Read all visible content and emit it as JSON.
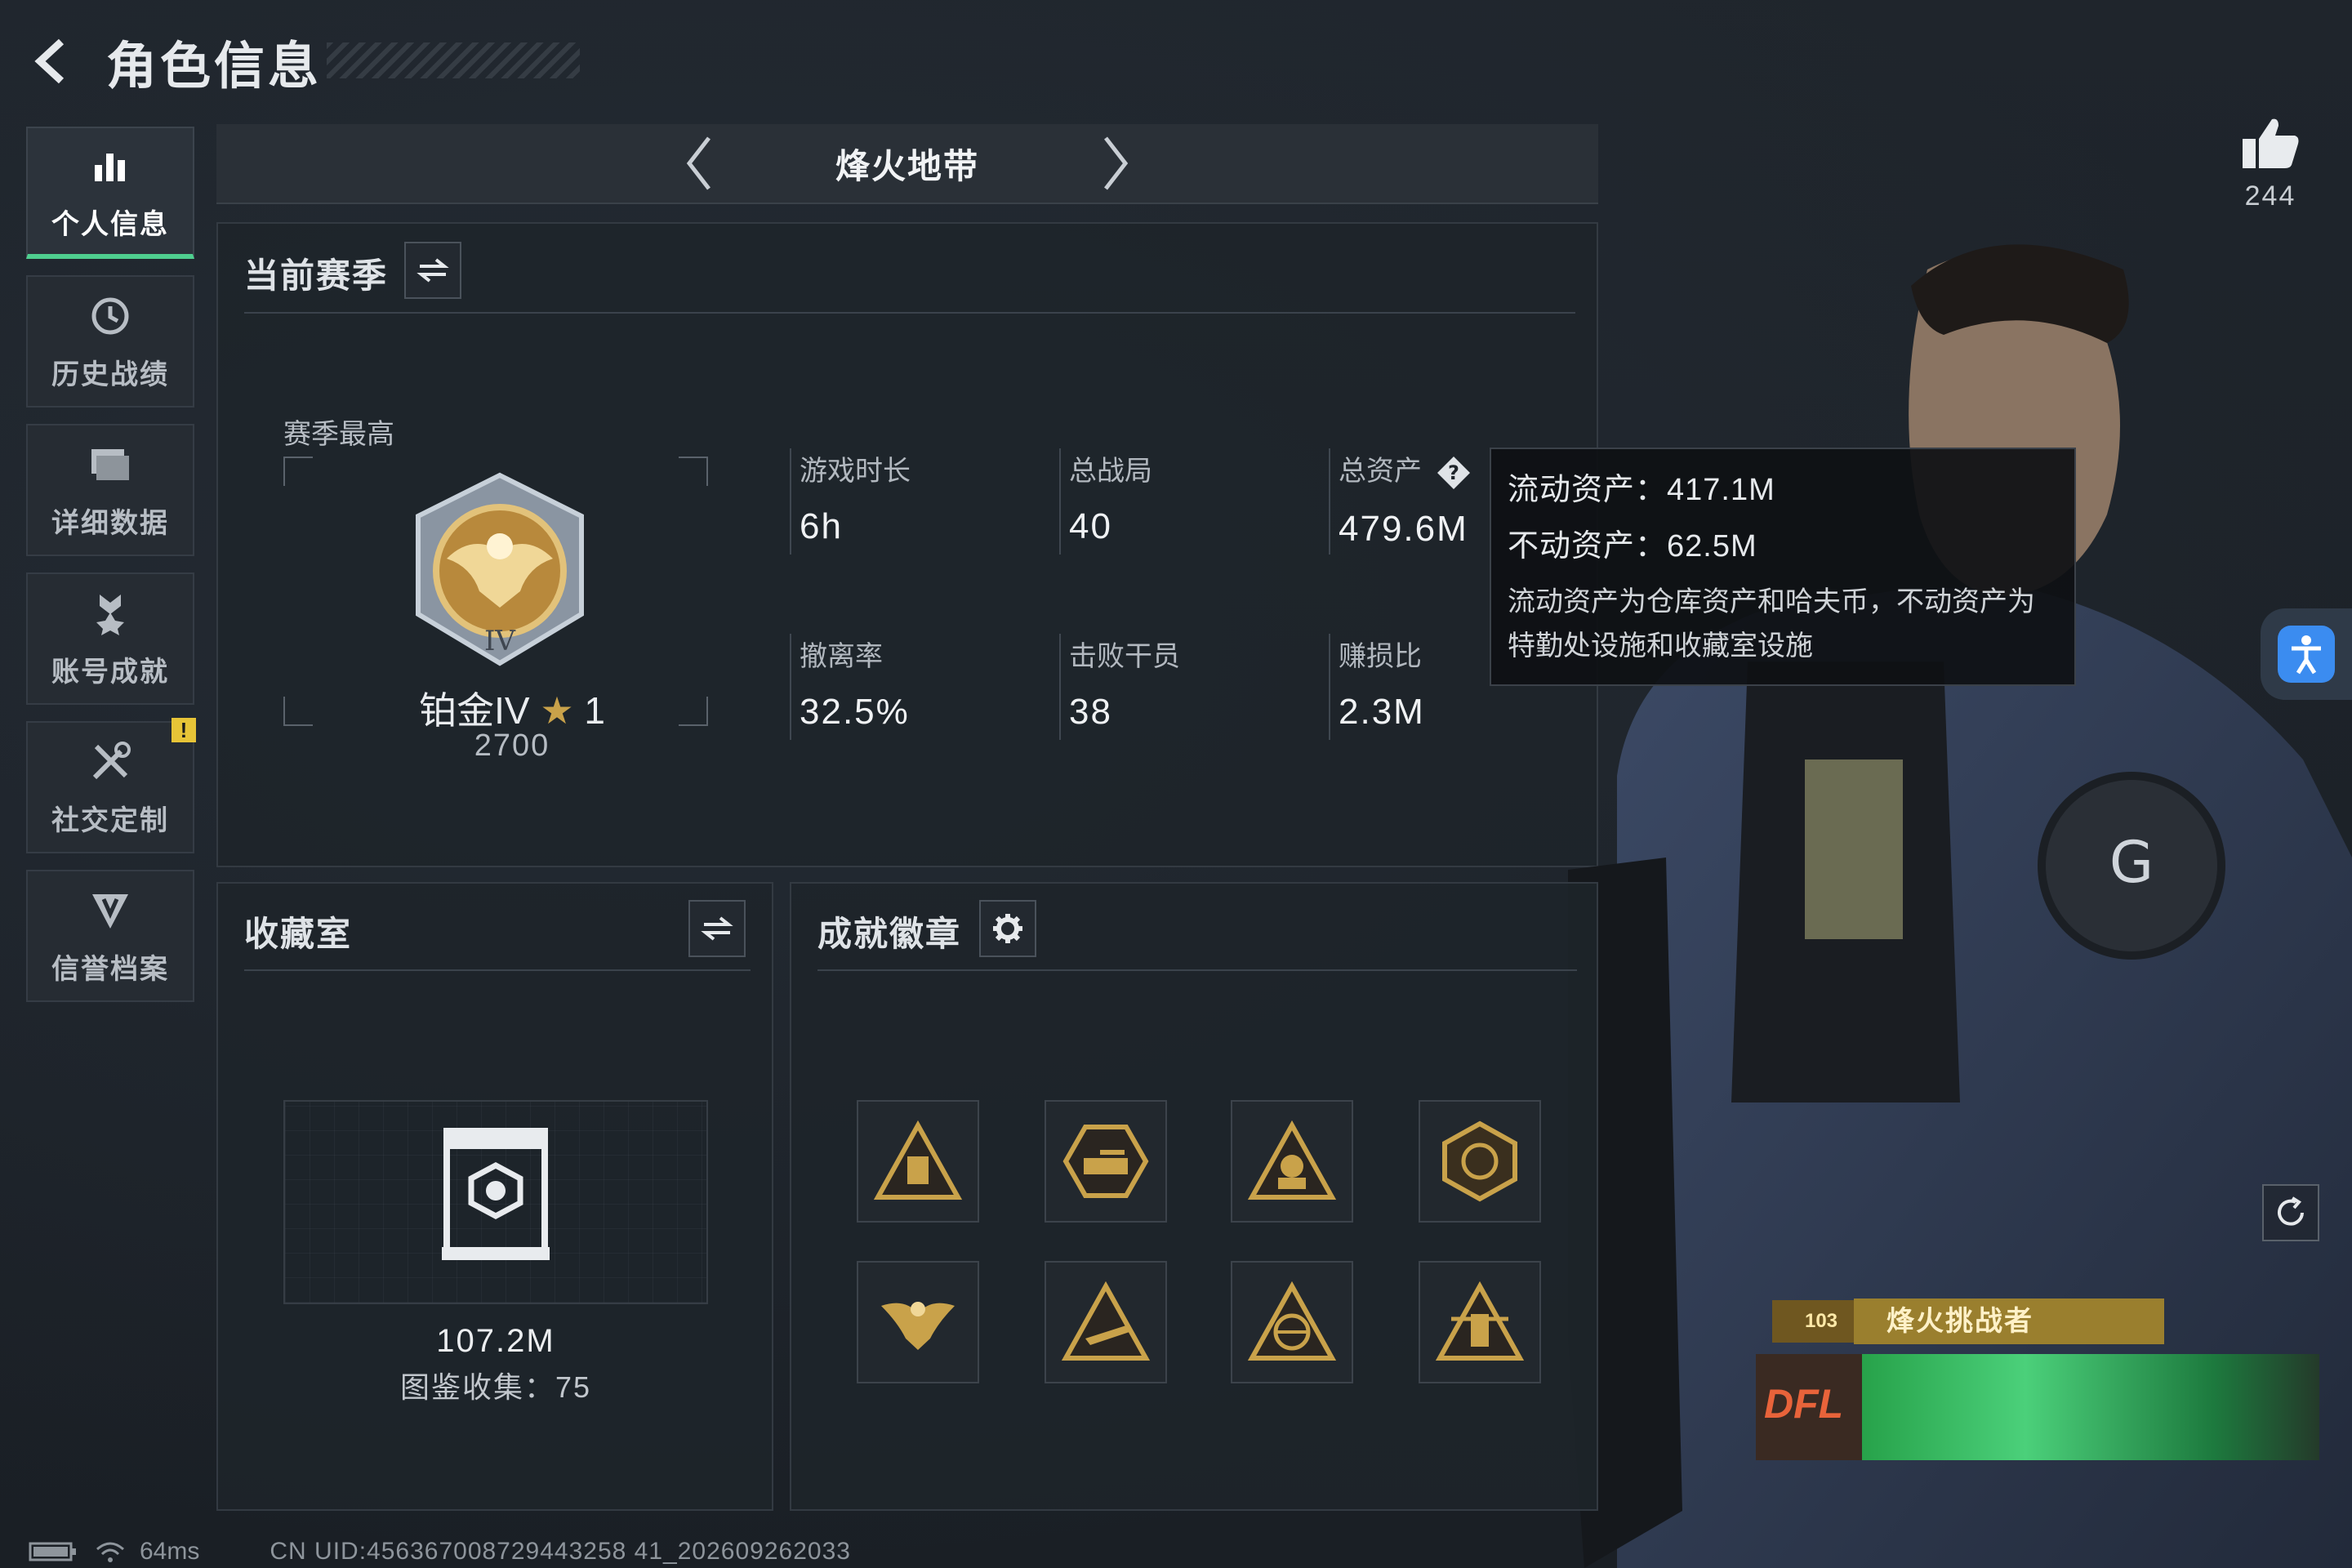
{
  "header": {
    "title": "角色信息"
  },
  "sidebar": {
    "items": [
      {
        "label": "个人信息",
        "active": true,
        "icon": "bar-chart-icon"
      },
      {
        "label": "历史战绩",
        "active": false,
        "icon": "clock-icon"
      },
      {
        "label": "详细数据",
        "active": false,
        "icon": "folder-icon"
      },
      {
        "label": "账号成就",
        "active": false,
        "icon": "medal-icon"
      },
      {
        "label": "社交定制",
        "active": false,
        "icon": "tools-icon",
        "badge": "!"
      },
      {
        "label": "信誉档案",
        "active": false,
        "icon": "shield-icon"
      }
    ]
  },
  "mode": {
    "title": "烽火地带"
  },
  "season": {
    "title": "当前赛季",
    "best_label": "赛季最高",
    "rank_name": "铂金IV",
    "rank_stars": "1",
    "rank_score": "2700",
    "stats": [
      {
        "label": "游戏时长",
        "value": "6h"
      },
      {
        "label": "总战局",
        "value": "40"
      },
      {
        "label": "总资产",
        "value": "479.6M",
        "has_help": true
      },
      {
        "label": "撤离率",
        "value": "32.5%"
      },
      {
        "label": "击败干员",
        "value": "38"
      },
      {
        "label": "赚损比",
        "value": "2.3M"
      }
    ]
  },
  "tooltip": {
    "liquid": "流动资产：417.1M",
    "fixed": "不动资产：62.5M",
    "desc": "流动资产为仓库资产和哈夫币，不动资产为特勤处设施和收藏室设施"
  },
  "collection": {
    "title": "收藏室",
    "value": "107.2M",
    "count": "图鉴收集：75"
  },
  "achievements": {
    "title": "成就徽章",
    "badges": [
      "triangle-badge",
      "tank-badge",
      "soldier-badge",
      "emblem-badge",
      "eagle-badge",
      "plane-badge",
      "globe-badge",
      "flag-badge"
    ]
  },
  "likes": {
    "count": "244"
  },
  "player_card": {
    "title": "烽火挑战者",
    "level": "103",
    "logo": "DFL"
  },
  "status": {
    "ping": "64ms",
    "uid": "CN UID:456367008729443258 41_202609262033"
  },
  "colors": {
    "accent_green": "#4fcf8f",
    "gold": "#c9a24a",
    "warning": "#e7c437",
    "blue": "#3b8cf0"
  }
}
